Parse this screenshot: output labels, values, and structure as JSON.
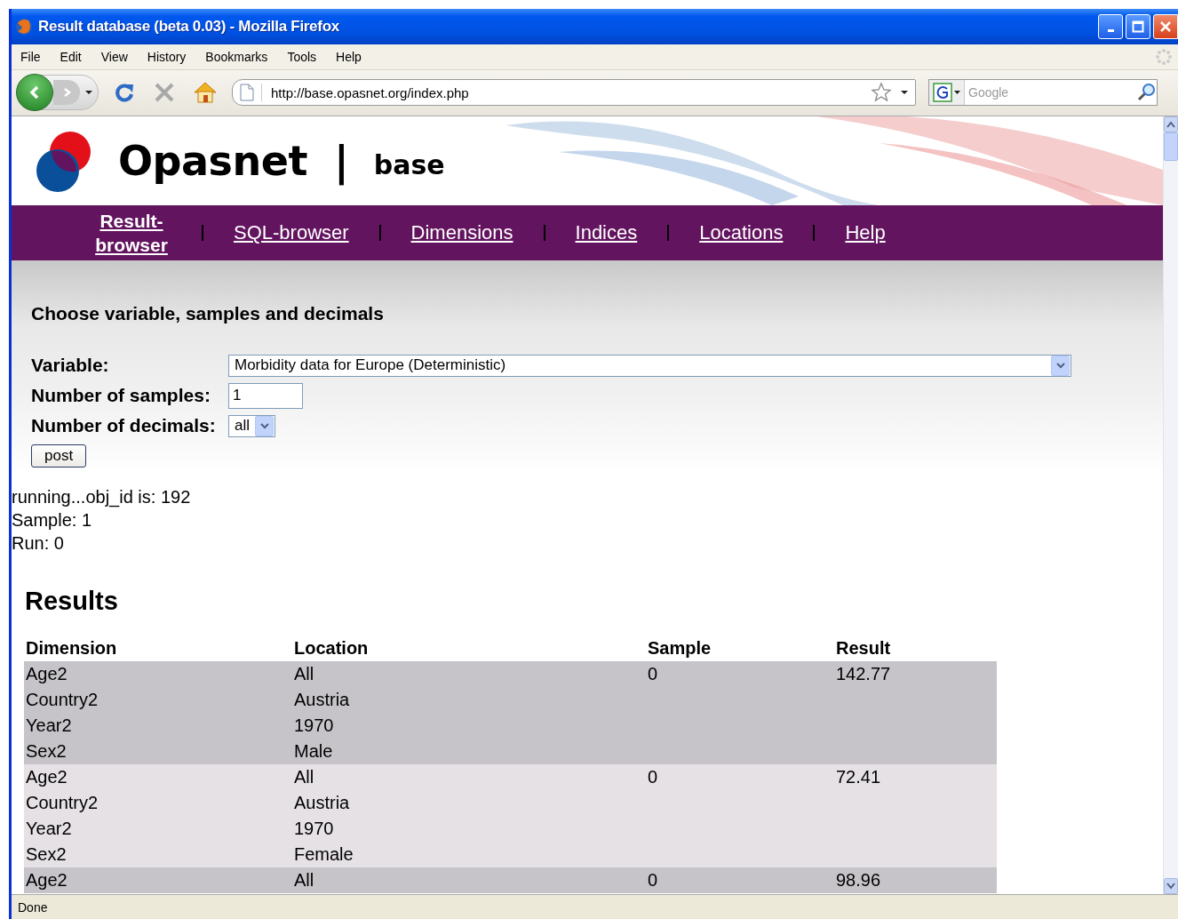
{
  "window": {
    "title": "Result database (beta 0.03) - Mozilla Firefox"
  },
  "menu": [
    "File",
    "Edit",
    "View",
    "History",
    "Bookmarks",
    "Tools",
    "Help"
  ],
  "toolbar": {
    "url": "http://base.opasnet.org/index.php",
    "search_placeholder": "Google"
  },
  "site": {
    "name": "Opasnet",
    "divider": "|",
    "section": "base"
  },
  "nav": [
    {
      "label": "Result-browser",
      "selected": true
    },
    {
      "label": "SQL-browser",
      "selected": false
    },
    {
      "label": "Dimensions",
      "selected": false
    },
    {
      "label": "Indices",
      "selected": false
    },
    {
      "label": "Locations",
      "selected": false
    },
    {
      "label": "Help",
      "selected": false
    }
  ],
  "form": {
    "heading": "Choose variable, samples and decimals",
    "fields": [
      {
        "label": "Variable:",
        "kind": "select",
        "value": "Morbidity data for Europe (Deterministic)"
      },
      {
        "label": "Number of samples:",
        "kind": "input",
        "value": "1"
      },
      {
        "label": "Number of decimals:",
        "kind": "select",
        "value": "all"
      }
    ],
    "button": "post"
  },
  "output": [
    "running...obj_id is: 192",
    "Sample: 1",
    "Run: 0"
  ],
  "results": {
    "heading": "Results",
    "columns": [
      "Dimension",
      "Location",
      "Sample",
      "Result"
    ],
    "records": [
      {
        "sample": "0",
        "result": "142.77",
        "pairs": [
          {
            "dimension": "Age2",
            "location": "All"
          },
          {
            "dimension": "Country2",
            "location": "Austria"
          },
          {
            "dimension": "Year2",
            "location": "1970"
          },
          {
            "dimension": "Sex2",
            "location": "Male"
          }
        ]
      },
      {
        "sample": "0",
        "result": "72.41",
        "pairs": [
          {
            "dimension": "Age2",
            "location": "All"
          },
          {
            "dimension": "Country2",
            "location": "Austria"
          },
          {
            "dimension": "Year2",
            "location": "1970"
          },
          {
            "dimension": "Sex2",
            "location": "Female"
          }
        ]
      },
      {
        "sample": "0",
        "result": "98.96",
        "pairs": [
          {
            "dimension": "Age2",
            "location": "All"
          }
        ]
      }
    ]
  },
  "status_bar": "Done"
}
